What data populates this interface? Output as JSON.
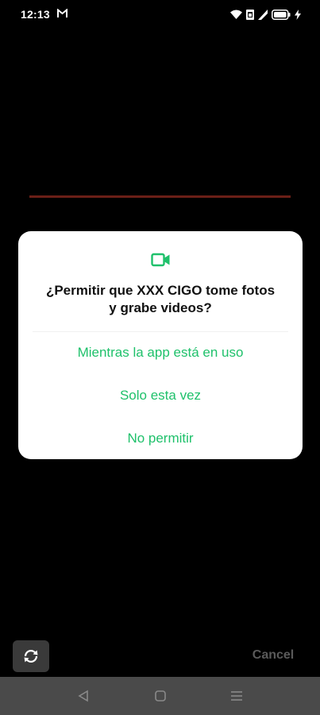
{
  "status_bar": {
    "time": "12:13",
    "icons": [
      "gmail-icon",
      "wifi-icon",
      "signal-1-icon",
      "signal-2-icon",
      "battery-icon",
      "charging-icon"
    ]
  },
  "dialog": {
    "icon": "videocam-icon",
    "title_line1": "¿Permitir que XXX CIGO tome fotos",
    "title_line2": "y grabe videos?",
    "options": [
      "Mientras la app está en uso",
      "Solo esta vez",
      "No permitir"
    ]
  },
  "camera": {
    "cancel_label": "Cancel",
    "switch_icon": "switch-camera-icon"
  },
  "nav_bar": {
    "icons": [
      "back-icon",
      "home-icon",
      "recents-icon"
    ]
  },
  "colors": {
    "accent": "#1fc16b",
    "background": "#000000",
    "dialog_bg": "#ffffff",
    "preview_line": "#6b1f17",
    "nav_bar": "#4a4a4a"
  }
}
